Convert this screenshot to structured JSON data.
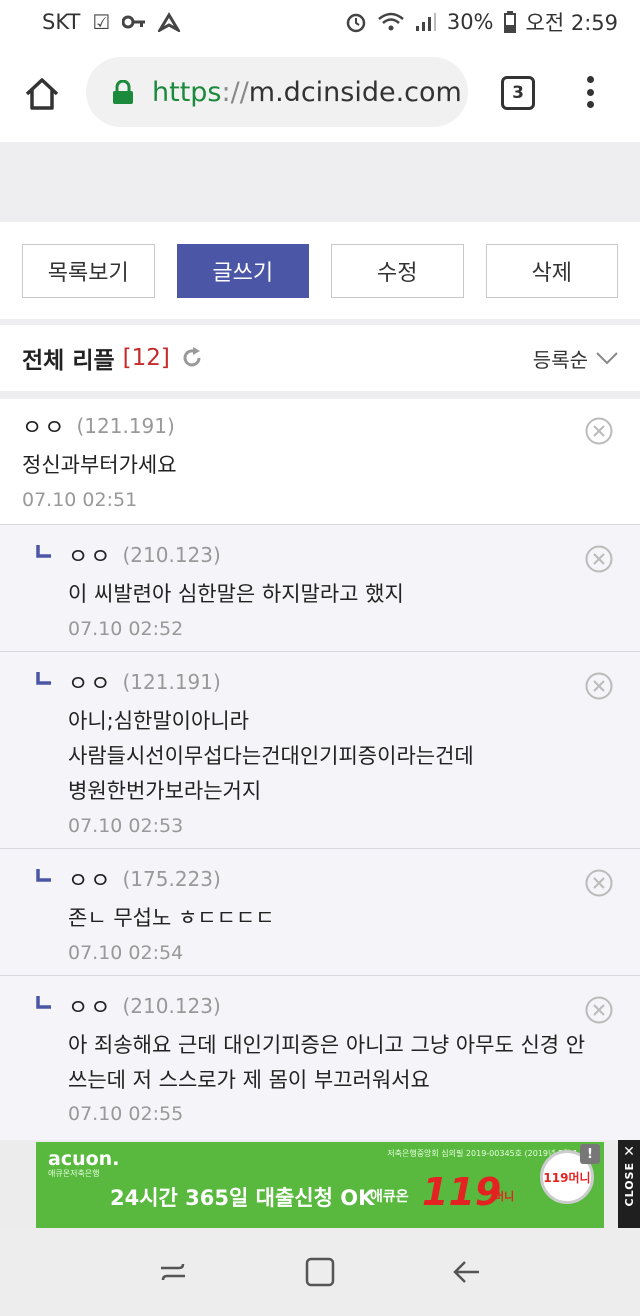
{
  "status_bar": {
    "carrier": "SKT",
    "battery": "30%",
    "time": "오전 2:59",
    "icons": [
      "checkbox-icon",
      "key-icon",
      "navigation-icon",
      "alarm-icon",
      "wifi-icon",
      "signal-icon",
      "battery-icon"
    ]
  },
  "browser": {
    "url_scheme": "https",
    "url_sep": "://",
    "url_host": "m.dcinside.com",
    "tab_count": "3"
  },
  "buttons": {
    "list": "목록보기",
    "write": "글쓰기",
    "edit": "수정",
    "delete": "삭제"
  },
  "replies": {
    "title": "전체 리플",
    "count": "[12]",
    "sort": "등록순"
  },
  "comments": [
    {
      "nick": "ㅇㅇ",
      "ip": "(121.191)",
      "lines": [
        "정신과부터가세요"
      ],
      "date": "07.10 02:51",
      "is_reply": false
    },
    {
      "nick": "ㅇㅇ",
      "ip": "(210.123)",
      "lines": [
        "이 씨발련아 심한말은 하지말라고 했지"
      ],
      "date": "07.10 02:52",
      "is_reply": true
    },
    {
      "nick": "ㅇㅇ",
      "ip": "(121.191)",
      "lines": [
        "아니;심한말이아니라",
        "사람들시선이무섭다는건대인기피증이라는건데",
        "병원한번가보라는거지"
      ],
      "date": "07.10 02:53",
      "is_reply": true
    },
    {
      "nick": "ㅇㅇ",
      "ip": "(175.223)",
      "lines": [
        "존ㄴ 무섭노 ㅎㄷㄷㄷㄷ"
      ],
      "date": "07.10 02:54",
      "is_reply": true
    },
    {
      "nick": "ㅇㅇ",
      "ip": "(210.123)",
      "lines": [
        "아 죄송해요 근데 대인기피증은 아니고 그냥 아무도 신경 안",
        "쓰는데 저 스스로가 제 몸이 부끄러워서요"
      ],
      "date": "07.10 02:55",
      "is_reply": true
    }
  ],
  "ad": {
    "logo": "acuon.",
    "logo_sub": "애큐온저축은행",
    "small": "저축은행중앙회 심의필 2019-00345호 (2019년 5월 1",
    "main": "24시간 365일 대출신청 OK",
    "brand": "애큐온",
    "number": "119",
    "money": "머니",
    "circle": "119머니",
    "close": "CLOSE",
    "close_x": "✕",
    "excl": "!"
  },
  "colors": {
    "primary_button": "#4b57a6",
    "reply_count": "#c62b2b",
    "url_scheme": "#1c8a3d",
    "ad_green": "#58b93e"
  }
}
